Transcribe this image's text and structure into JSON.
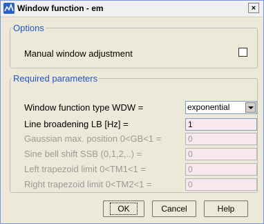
{
  "window": {
    "title": "Window function - em",
    "close_glyph": "×"
  },
  "options": {
    "legend": "Options",
    "manual_label": "Manual window adjustment",
    "manual_checked": false
  },
  "required": {
    "legend": "Required parameters",
    "wdw_label": "Window function type WDW =",
    "wdw_value": "exponential",
    "lb_label": "Line broadening LB [Hz] =",
    "lb_value": "1",
    "gb_label": "Gaussian max. position 0<GB<1 =",
    "gb_value": "0",
    "ssb_label": "Sine bell shift SSB (0,1,2,..) =",
    "ssb_value": "0",
    "tm1_label": "Left trapezoid limit 0<TM1<1 =",
    "tm1_value": "0",
    "tm2_label": "Right trapezoid limit 0<TM2<1 =",
    "tm2_value": "0"
  },
  "buttons": {
    "ok": "OK",
    "cancel": "Cancel",
    "help": "Help"
  },
  "icons": {
    "title": "topspin-app-icon",
    "dropdown": "chevron-down-icon"
  }
}
